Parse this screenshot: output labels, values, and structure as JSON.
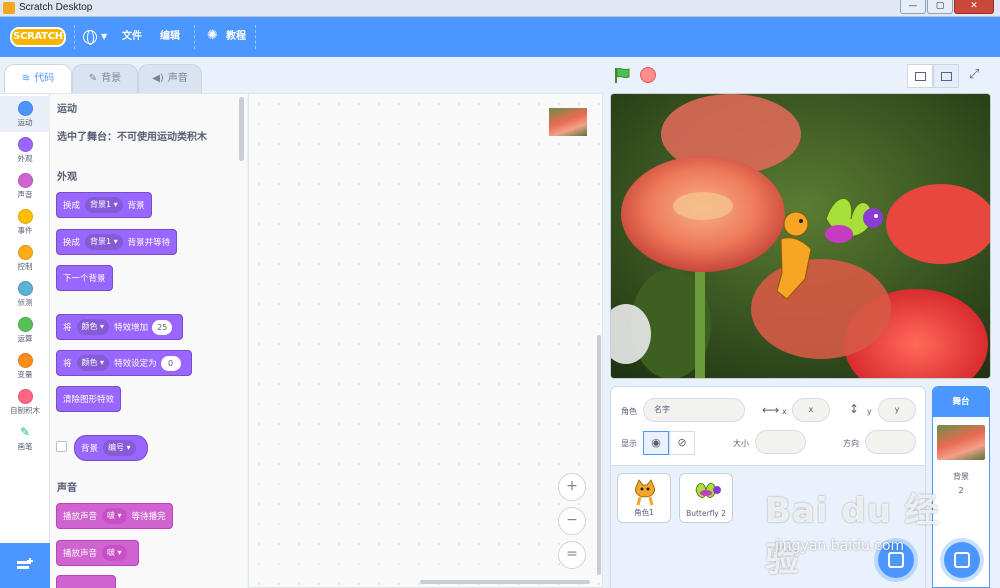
{
  "window": {
    "title": "Scratch Desktop",
    "buttons": [
      "—",
      "▢",
      "✕"
    ]
  },
  "menubar": {
    "logo": "SCRATCH",
    "file": "文件",
    "edit": "编辑",
    "tutorials": "教程"
  },
  "tabs": {
    "code": "代码",
    "costumes": "背景",
    "sounds": "声音"
  },
  "categories": [
    {
      "label": "运动",
      "color": "#4c97ff"
    },
    {
      "label": "外观",
      "color": "#9966ff"
    },
    {
      "label": "声音",
      "color": "#cf63cf"
    },
    {
      "label": "事件",
      "color": "#ffbf00"
    },
    {
      "label": "控制",
      "color": "#ffab19"
    },
    {
      "label": "侦测",
      "color": "#5cb1d6"
    },
    {
      "label": "运算",
      "color": "#59c059"
    },
    {
      "label": "变量",
      "color": "#ff8c1a"
    },
    {
      "label": "自制积木",
      "color": "#ff6680"
    },
    {
      "label": "画笔",
      "color": "#0fbd8c"
    }
  ],
  "palette": {
    "motion_title": "运动",
    "motion_note": "选中了舞台：不可使用运动类积木",
    "looks_title": "外观",
    "b1": {
      "a": "换成",
      "dd": "背景1 ▾",
      "b": "背景"
    },
    "b2": {
      "a": "换成",
      "dd": "背景1 ▾",
      "b": "背景并等待"
    },
    "b3": {
      "a": "下一个背景"
    },
    "b4": {
      "a": "将",
      "dd": "颜色 ▾",
      "b": "特效增加",
      "num": "25"
    },
    "b5": {
      "a": "将",
      "dd": "颜色 ▾",
      "b": "特效设定为",
      "num": "0"
    },
    "b6": {
      "a": "清除图形特效"
    },
    "b7": {
      "a": "背景",
      "dd": "编号 ▾"
    },
    "sound_title": "声音",
    "b8": {
      "a": "播放声音",
      "dd": "啵 ▾",
      "b": "等待播完"
    },
    "b9": {
      "a": "播放声音",
      "dd": "啵 ▾"
    }
  },
  "zoom": {
    "in": "+",
    "out": "−",
    "reset": "="
  },
  "sprite_info": {
    "sprite_label": "角色",
    "name_placeholder": "名字",
    "x_label": "x",
    "x_placeholder": "x",
    "y_label": "y",
    "y_placeholder": "y",
    "show_label": "显示",
    "size_label": "大小",
    "direction_label": "方向"
  },
  "sprites": [
    {
      "name": "角色1"
    },
    {
      "name": "Butterfly 2"
    }
  ],
  "stage_selector": {
    "title": "舞台",
    "backdrops_label": "背景",
    "backdrops_count": "2"
  },
  "watermark": {
    "brand": "Bai du 经验",
    "url": "jingyan.baidu.com"
  },
  "colors": {
    "accent": "#4c97ff",
    "looks": "#9966ff",
    "sound": "#cf63cf"
  }
}
